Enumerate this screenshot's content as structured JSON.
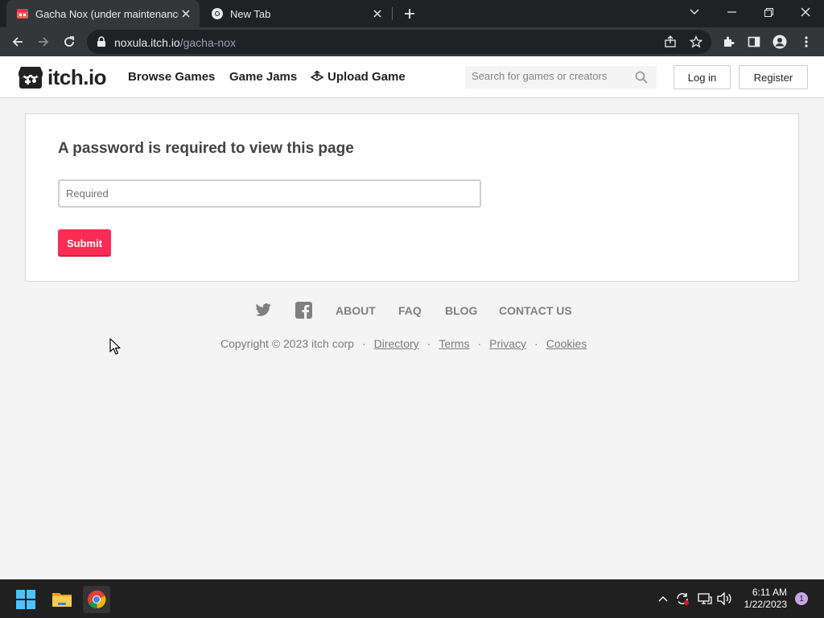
{
  "browser": {
    "tabs": [
      {
        "title": "Gacha Nox (under maintenance)",
        "active": true
      },
      {
        "title": "New Tab",
        "active": false
      }
    ],
    "url_host": "noxula.itch.io",
    "url_path": "/gacha-nox"
  },
  "header": {
    "logo_text": "itch.io",
    "nav": [
      "Browse Games",
      "Game Jams",
      "Upload Game"
    ],
    "search_placeholder": "Search for games or creators",
    "login": "Log in",
    "register": "Register"
  },
  "main": {
    "heading": "A password is required to view this page",
    "password_placeholder": "Required",
    "submit": "Submit"
  },
  "footer": {
    "links": [
      "ABOUT",
      "FAQ",
      "BLOG",
      "CONTACT US"
    ],
    "copyright": "Copyright © 2023 itch corp",
    "legal": [
      "Directory",
      "Terms",
      "Privacy",
      "Cookies"
    ],
    "separator": "·"
  },
  "taskbar": {
    "time": "6:11 AM",
    "date": "1/22/2023",
    "notification_count": "1"
  },
  "colors": {
    "accent": "#fa2c53",
    "chrome_dark": "#202124",
    "chrome_toolbar": "#35363a"
  }
}
